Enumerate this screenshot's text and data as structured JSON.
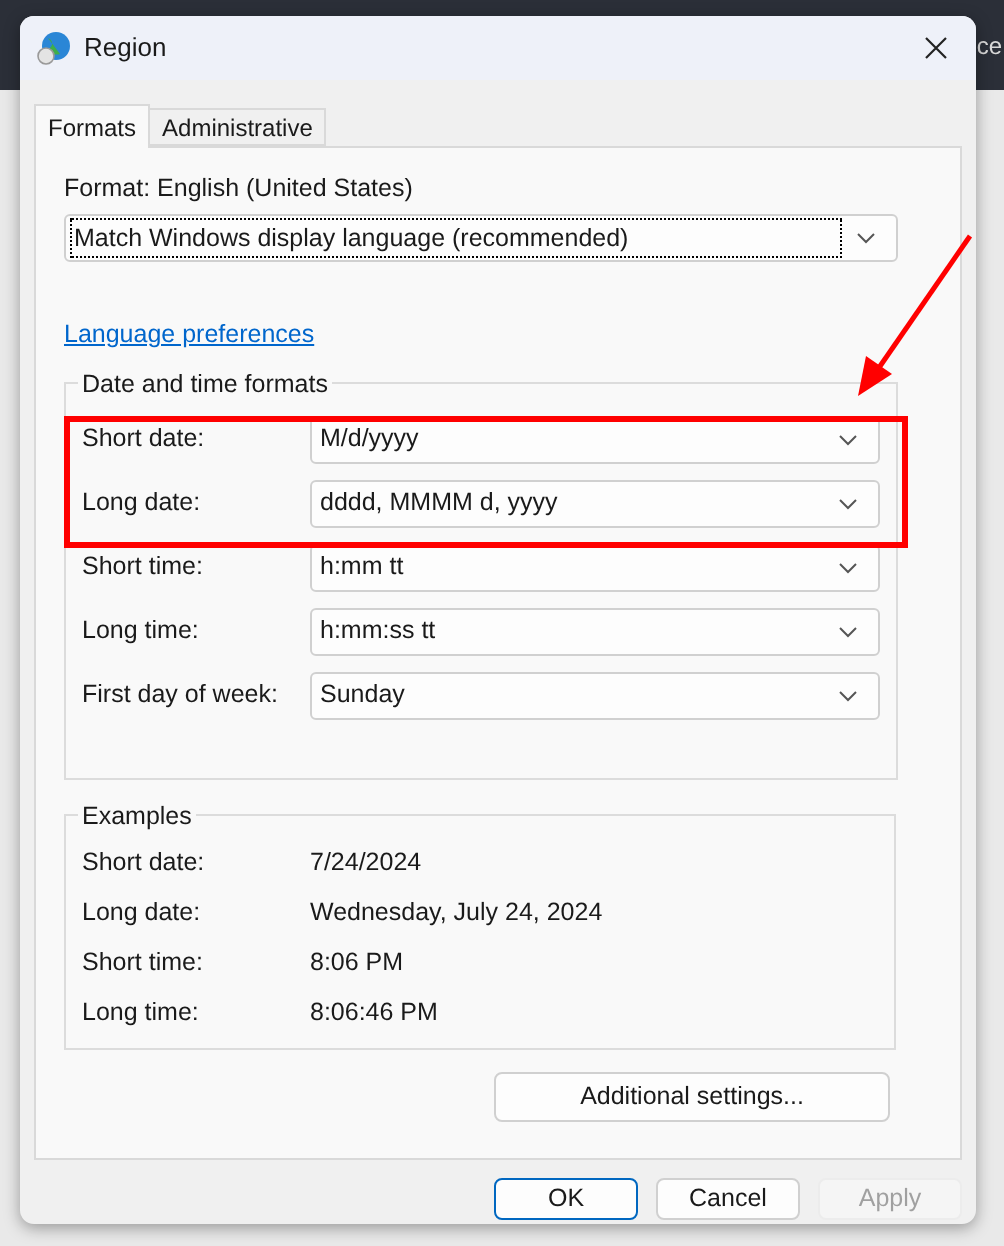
{
  "background_text": "ce",
  "window": {
    "title": "Region"
  },
  "tabs": [
    {
      "label": "Formats",
      "selected": true
    },
    {
      "label": "Administrative",
      "selected": false
    }
  ],
  "format": {
    "label": "Format: English (United States)",
    "value": "Match Windows display language (recommended)",
    "focused": true
  },
  "language_link": "Language preferences",
  "date_time_formats": {
    "title": "Date and time formats",
    "rows": [
      {
        "label": "Short date:",
        "value": "M/d/yyyy"
      },
      {
        "label": "Long date:",
        "value": "dddd, MMMM d, yyyy"
      },
      {
        "label": "Short time:",
        "value": "h:mm tt"
      },
      {
        "label": "Long time:",
        "value": "h:mm:ss tt"
      },
      {
        "label": "First day of week:",
        "value": "Sunday"
      }
    ]
  },
  "examples": {
    "title": "Examples",
    "rows": [
      {
        "label": "Short date:",
        "value": "7/24/2024"
      },
      {
        "label": "Long date:",
        "value": "Wednesday, July 24, 2024"
      },
      {
        "label": "Short time:",
        "value": "8:06 PM"
      },
      {
        "label": "Long time:",
        "value": "8:06:46 PM"
      }
    ]
  },
  "additional_settings": "Additional settings...",
  "buttons": [
    {
      "label": "OK",
      "default": true,
      "disabled": false
    },
    {
      "label": "Cancel",
      "default": false,
      "disabled": false
    },
    {
      "label": "Apply",
      "default": false,
      "disabled": true
    }
  ]
}
